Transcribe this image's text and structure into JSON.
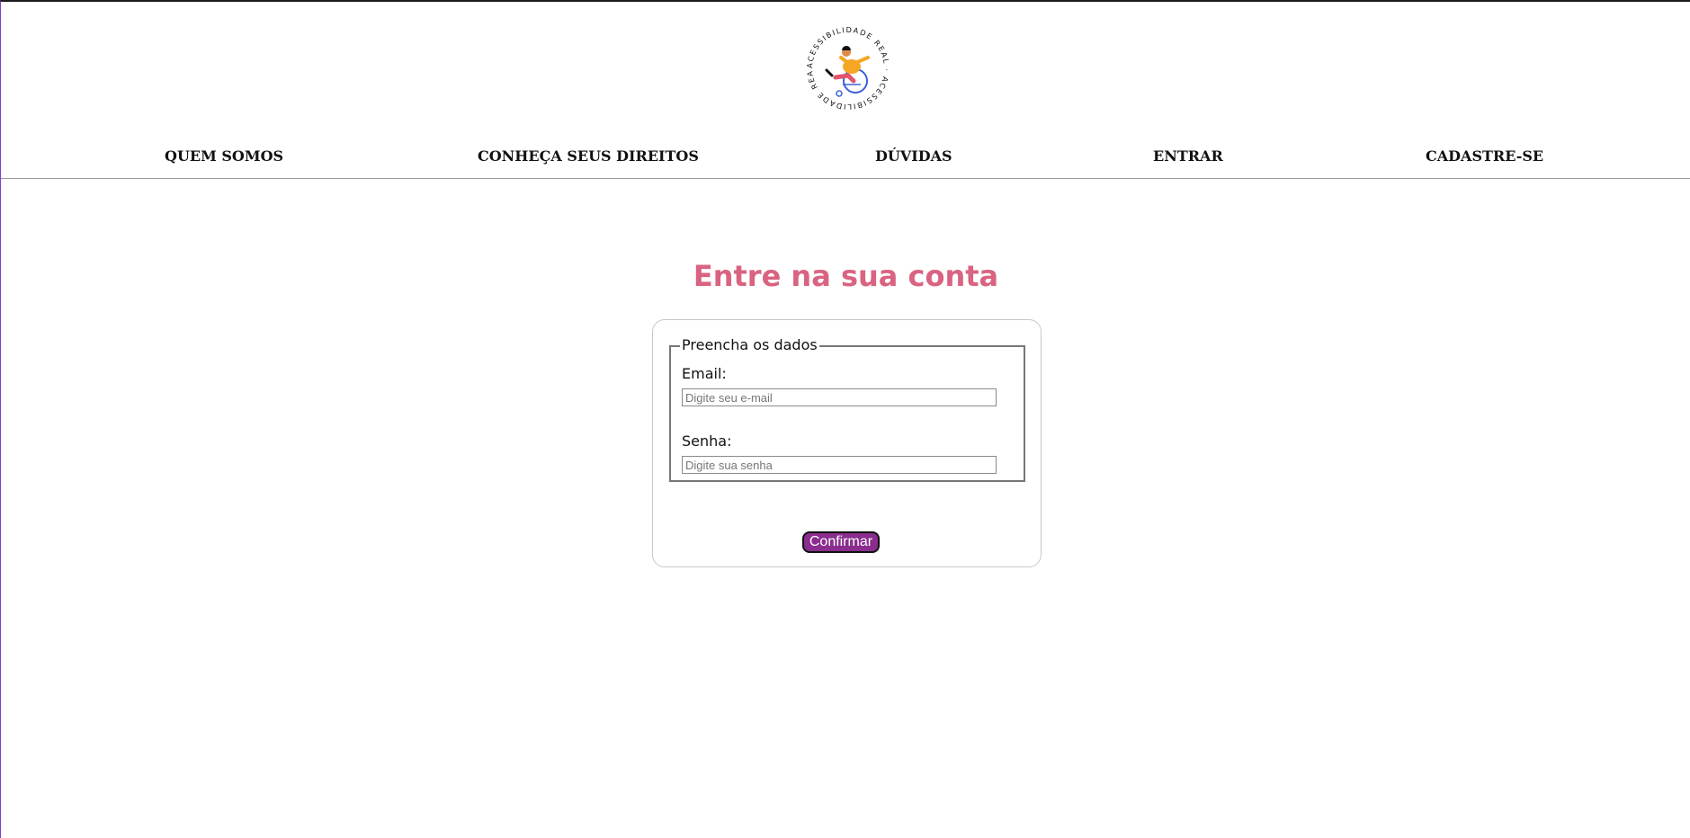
{
  "logo": {
    "text": "ACESSIBILIDADE REAL · ACESSIBILIDADE REAL ·",
    "icon": "wheelchair-person-logo"
  },
  "nav": {
    "items": [
      {
        "label": "QUEM SOMOS"
      },
      {
        "label": "CONHEÇA SEUS DIREITOS"
      },
      {
        "label": "DÚVIDAS"
      },
      {
        "label": "ENTRAR"
      },
      {
        "label": "CADASTRE-SE"
      }
    ]
  },
  "main": {
    "title": "Entre na sua conta",
    "form": {
      "legend": "Preencha os dados",
      "email_label": "Email:",
      "email_placeholder": "Digite seu e-mail",
      "email_value": "",
      "password_label": "Senha:",
      "password_placeholder": "Digite sua senha",
      "password_value": "",
      "submit_label": "Confirmar"
    }
  },
  "colors": {
    "title": "#d96381",
    "button": "#8a2d8e",
    "logo_figure": "#f5a623",
    "logo_accent": "#e2546e",
    "logo_wheel": "#3b63d6"
  }
}
